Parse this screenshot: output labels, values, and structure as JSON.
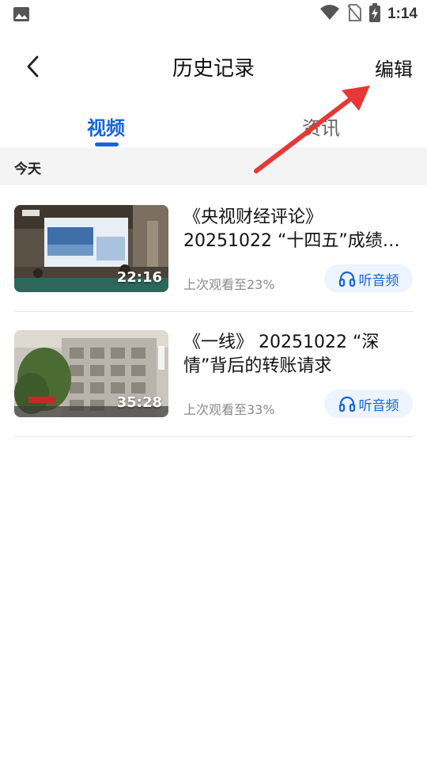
{
  "status_bar": {
    "time": "1:14",
    "icons": [
      "image-icon",
      "wifi-icon",
      "no-sim-icon",
      "battery-charging-icon"
    ]
  },
  "header": {
    "title": "历史记录",
    "back_icon": "chevron-left-icon",
    "edit_label": "编辑"
  },
  "tabs": [
    {
      "label": "视频",
      "active": true
    },
    {
      "label": "资讯",
      "active": false
    }
  ],
  "section": {
    "title": "今天"
  },
  "history": [
    {
      "title": "《央视财经评论》 20251022 “十四五”成绩单…",
      "duration": "22:16",
      "progress": "上次观看至23%",
      "audio_label": "听音频"
    },
    {
      "title": "《一线》 20251022 “深情”背后的转账请求",
      "duration": "35:28",
      "progress": "上次观看至33%",
      "audio_label": "听音频"
    }
  ],
  "colors": {
    "accent": "#1565e0",
    "annotation_arrow": "#e53935"
  }
}
